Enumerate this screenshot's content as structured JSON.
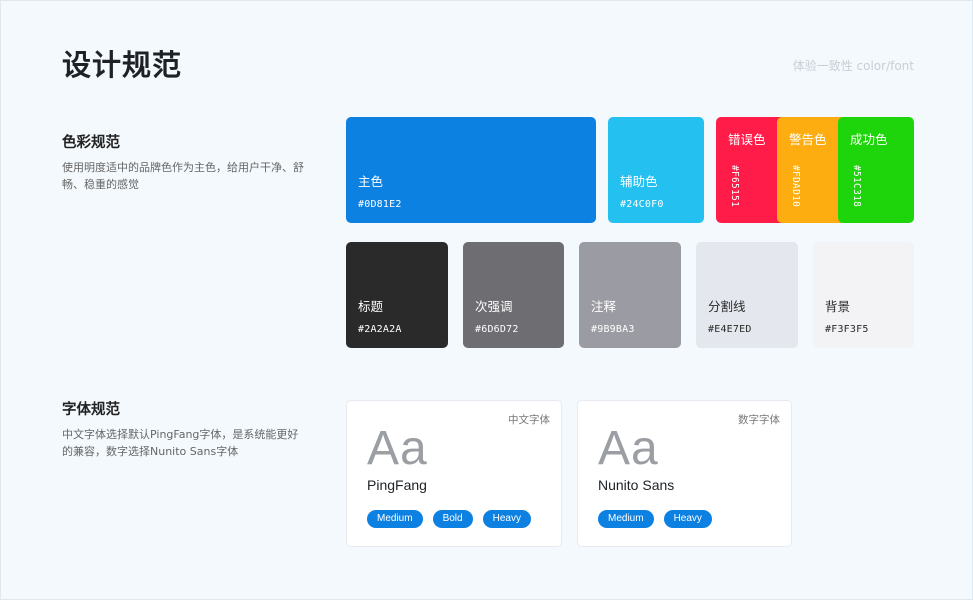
{
  "page": {
    "title": "设计规范",
    "subtitle": "体验一致性 color/font"
  },
  "color_section": {
    "title": "色彩规范",
    "description": "使用明度适中的品牌色作为主色，给用户干净、舒畅、稳重的感觉",
    "primary": {
      "name": "主色",
      "hex": "#0D81E2",
      "color": "#0D81E2"
    },
    "secondary": {
      "name": "辅助色",
      "hex": "#24C0F0",
      "color": "#24C0F0"
    },
    "status": [
      {
        "name": "错误色",
        "hex": "#F65151",
        "color": "#FF1C48"
      },
      {
        "name": "警告色",
        "hex": "#FDAD10",
        "color": "#FDAD10"
      },
      {
        "name": "成功色",
        "hex": "#51C318",
        "color": "#1ED40A"
      }
    ],
    "neutrals": [
      {
        "name": "标题",
        "hex": "#2A2A2A",
        "color": "#2A2A2A"
      },
      {
        "name": "次强调",
        "hex": "#6D6D72",
        "color": "#6D6D72"
      },
      {
        "name": "注释",
        "hex": "#9B9BA3",
        "color": "#9B9BA3"
      },
      {
        "name": "分割线",
        "hex": "#E4E7ED",
        "color": "#E4E7ED"
      },
      {
        "name": "背景",
        "hex": "#F3F3F5",
        "color": "#F3F3F5"
      }
    ]
  },
  "font_section": {
    "title": "字体规范",
    "description": "中文字体选择默认PingFang字体，是系统能更好的兼容，数字选择Nunito Sans字体",
    "cards": [
      {
        "tag": "中文字体",
        "sample": "Aa",
        "font_name": "PingFang",
        "weights": [
          "Medium",
          "Bold",
          "Heavy"
        ]
      },
      {
        "tag": "数字字体",
        "sample": "Aa",
        "font_name": "Nunito Sans",
        "weights": [
          "Medium",
          "Heavy"
        ]
      }
    ],
    "pill_color": "#0D81E2"
  }
}
